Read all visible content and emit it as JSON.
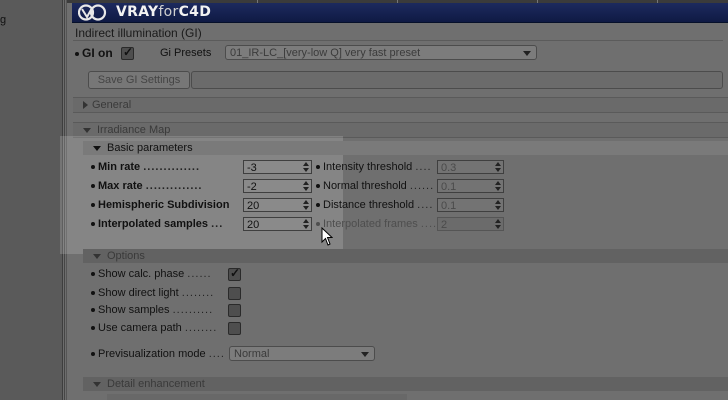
{
  "left_panel": {
    "fragment": "g"
  },
  "banner": {
    "logo_main": "VRAY",
    "logo_for": "for",
    "logo_c4d": "C4D"
  },
  "section_title": "Indirect illumination (GI)",
  "gi_on": {
    "label": "GI on",
    "checked": true
  },
  "gi_presets": {
    "label": "Gi Presets",
    "value": "01_IR-LC_[very-low Q] very fast preset"
  },
  "save_button": "Save GI Settings",
  "groups": {
    "general": "General",
    "irradiance_map": "Irradiance Map",
    "basic_parameters": "Basic parameters",
    "options": "Options",
    "detail_enhancement": "Detail enhancement"
  },
  "basic_left": [
    {
      "label": "Min rate",
      "dots": "..............",
      "value": "-3"
    },
    {
      "label": "Max rate",
      "dots": "..............",
      "value": "-2"
    },
    {
      "label": "Hemispheric Subdivision",
      "dots": "",
      "value": "20"
    },
    {
      "label": "Interpolated samples",
      "dots": "...",
      "value": "20"
    }
  ],
  "basic_right": [
    {
      "label": "Intensity threshold",
      "dots": "....",
      "value": "0.3"
    },
    {
      "label": "Normal threshold",
      "dots": "......",
      "value": "0.1"
    },
    {
      "label": "Distance threshold",
      "dots": "....",
      "value": "0.1"
    },
    {
      "label": "Interpolated frames",
      "dots": "....",
      "value": "2"
    }
  ],
  "options": [
    {
      "label": "Show calc. phase",
      "dots": "......",
      "checked": true
    },
    {
      "label": "Show direct light",
      "dots": "........",
      "checked": false
    },
    {
      "label": "Show samples",
      "dots": "..........",
      "checked": false
    },
    {
      "label": "Use camera path",
      "dots": "........",
      "checked": false
    }
  ],
  "previsualization": {
    "label": "Previsualization mode",
    "dots": "....",
    "value": "Normal"
  },
  "colors": {
    "banner": "#152256",
    "panel": "#6f6f6f",
    "highlight": "#d7d7d7"
  }
}
